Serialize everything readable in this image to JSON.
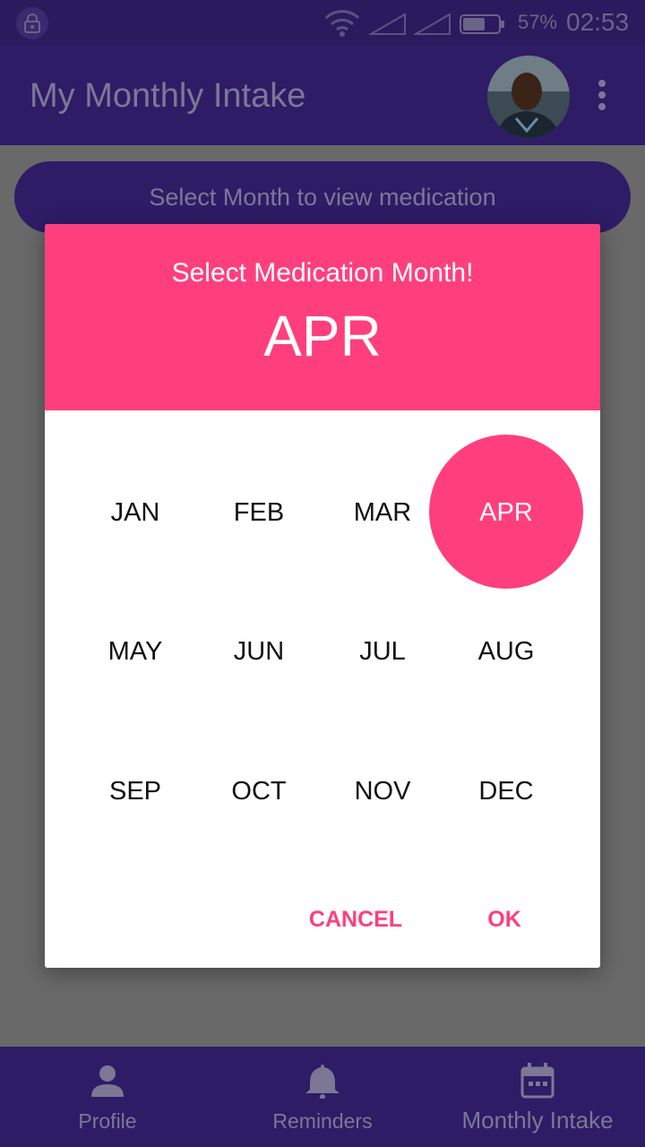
{
  "status_bar": {
    "battery": "57%",
    "time": "02:53"
  },
  "app_bar": {
    "title": "My Monthly Intake"
  },
  "main": {
    "select_month_button": "Select Month to view medication"
  },
  "dialog": {
    "subtitle": "Select Medication Month!",
    "selected_month": "APR",
    "months": [
      "JAN",
      "FEB",
      "MAR",
      "APR",
      "MAY",
      "JUN",
      "JUL",
      "AUG",
      "SEP",
      "OCT",
      "NOV",
      "DEC"
    ],
    "cancel_label": "CANCEL",
    "ok_label": "OK",
    "accent_color": "#ff3f7d"
  },
  "bottom_nav": {
    "items": [
      {
        "label": "Profile",
        "icon": "person-icon"
      },
      {
        "label": "Reminders",
        "icon": "bell-icon"
      },
      {
        "label": "Monthly Intake",
        "icon": "calendar-icon"
      }
    ],
    "active": "Monthly Intake"
  },
  "colors": {
    "primary": "#2e1c66",
    "scrim": "#696969"
  }
}
